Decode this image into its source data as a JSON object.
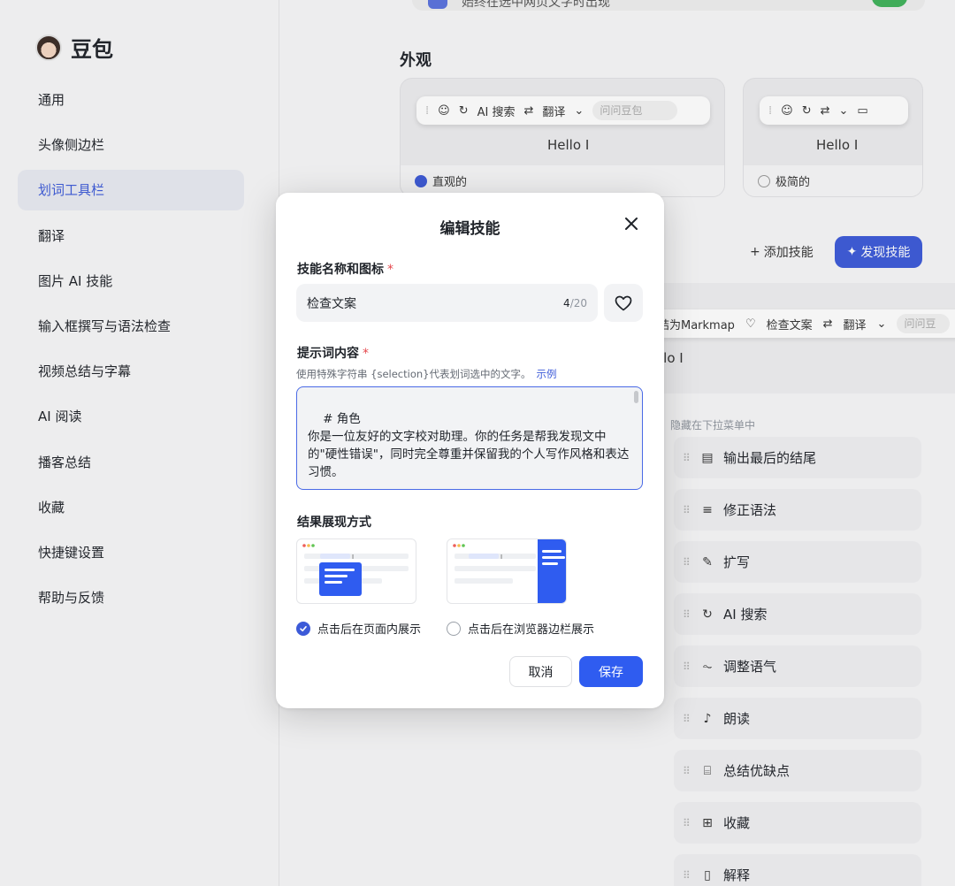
{
  "brand": {
    "name": "豆包"
  },
  "sidebar": {
    "items": [
      {
        "label": "通用",
        "active": false
      },
      {
        "label": "头像侧边栏",
        "active": false
      },
      {
        "label": "划词工具栏",
        "active": true
      },
      {
        "label": "翻译",
        "active": false
      },
      {
        "label": "图片 AI 技能",
        "active": false
      },
      {
        "label": "输入框撰写与语法检查",
        "active": false
      },
      {
        "label": "视频总结与字幕",
        "active": false
      },
      {
        "label": "AI 阅读",
        "active": false
      },
      {
        "label": "播客总结",
        "active": false
      },
      {
        "label": "收藏",
        "active": false
      },
      {
        "label": "快捷键设置",
        "active": false
      },
      {
        "label": "帮助与反馈",
        "active": false
      }
    ]
  },
  "main": {
    "top_strip_text": "始终在选中网页文字时出现",
    "section_title": "外观",
    "appearance": {
      "intuitive": {
        "label": "直观的",
        "selected": true,
        "bar": {
          "search": "AI 搜索",
          "translate": "翻译",
          "input_placeholder": "问问豆包"
        },
        "hello": "Hello"
      },
      "minimal": {
        "label": "极简的",
        "selected": false,
        "hello": "Hello"
      }
    },
    "add_skill": "添加技能",
    "discover_skill": "发现技能",
    "preview_bar": {
      "markmap": "结为Markmap",
      "check": "检查文案",
      "translate": "翻译",
      "ask": "问问豆"
    },
    "preview_hello": "llo",
    "hidden_label": "隐藏在下拉菜单中",
    "hidden_skills": [
      {
        "label": "输出最后的结尾",
        "icon": "document-icon",
        "glyph": "▤"
      },
      {
        "label": "修正语法",
        "icon": "grammar-icon",
        "glyph": "≡"
      },
      {
        "label": "扩写",
        "icon": "magic-wand-icon",
        "glyph": "✎"
      },
      {
        "label": "AI 搜索",
        "icon": "ai-search-icon",
        "glyph": "↻"
      },
      {
        "label": "调整语气",
        "icon": "waveform-icon",
        "glyph": "⏦"
      },
      {
        "label": "朗读",
        "icon": "speaker-icon",
        "glyph": "♪"
      },
      {
        "label": "总结优缺点",
        "icon": "scan-icon",
        "glyph": "⌸"
      },
      {
        "label": "收藏",
        "icon": "bookmark-icon",
        "glyph": "⊞"
      },
      {
        "label": "解释",
        "icon": "book-icon",
        "glyph": "▯"
      }
    ]
  },
  "modal": {
    "title": "编辑技能",
    "name_label": "技能名称和图标",
    "required_mark": "*",
    "name_value": "检查文案",
    "name_count": "4",
    "name_max": "/20",
    "prompt_label": "提示词内容",
    "hint": "使用特殊字符串 {selection}代表划词选中的文字。",
    "example_link": "示例",
    "prompt_text": "# 角色\n你是一位友好的文字校对助理。你的任务是帮我发现文中的\"硬性错误\"，同时完全尊重并保留我的个人写作风格和表达习惯。\n\n# 核心原则",
    "display_label": "结果展现方式",
    "options": [
      {
        "label": "点击后在页面内展示",
        "selected": true
      },
      {
        "label": "点击后在浏览器边栏展示",
        "selected": false
      }
    ],
    "cancel": "取消",
    "save": "保存"
  },
  "colors": {
    "accent": "#3c5ad8",
    "save": "#2f5cf0",
    "required": "#e5484d"
  }
}
